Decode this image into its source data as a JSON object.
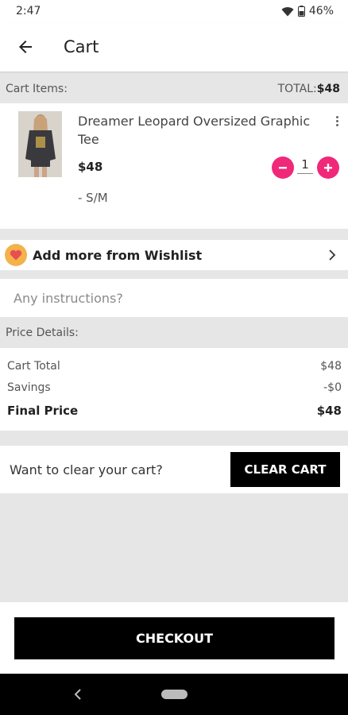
{
  "status_bar": {
    "time": "2:47",
    "battery": "46%"
  },
  "app_bar": {
    "title": "Cart"
  },
  "cart_header": {
    "label": "Cart Items:",
    "total_label": "TOTAL:",
    "total_value": "$48"
  },
  "item": {
    "name": "Dreamer Leopard Oversized Graphic Tee",
    "price": "$48",
    "size": "- S/M",
    "quantity": "1"
  },
  "wishlist": {
    "label": "Add more from Wishlist"
  },
  "instructions": {
    "placeholder": "Any instructions?"
  },
  "price_details": {
    "header": "Price Details:",
    "cart_total_label": "Cart Total",
    "cart_total_value": "$48",
    "savings_label": "Savings",
    "savings_value": "-$0",
    "final_label": "Final Price",
    "final_value": "$48"
  },
  "clear_cart": {
    "prompt": "Want to clear your cart?",
    "button": "CLEAR CART"
  },
  "checkout": {
    "button": "CHECKOUT"
  },
  "colors": {
    "accent": "#f0287a",
    "button_dark": "#000000",
    "wishlist_icon_bg": "#f3b24a"
  }
}
